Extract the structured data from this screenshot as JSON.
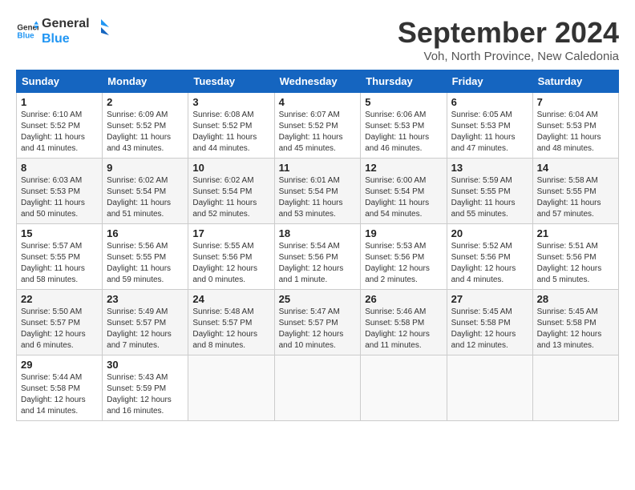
{
  "header": {
    "logo_line1": "General",
    "logo_line2": "Blue",
    "title": "September 2024",
    "subtitle": "Voh, North Province, New Caledonia"
  },
  "weekdays": [
    "Sunday",
    "Monday",
    "Tuesday",
    "Wednesday",
    "Thursday",
    "Friday",
    "Saturday"
  ],
  "weeks": [
    [
      {
        "day": "1",
        "info": "Sunrise: 6:10 AM\nSunset: 5:52 PM\nDaylight: 11 hours\nand 41 minutes."
      },
      {
        "day": "2",
        "info": "Sunrise: 6:09 AM\nSunset: 5:52 PM\nDaylight: 11 hours\nand 43 minutes."
      },
      {
        "day": "3",
        "info": "Sunrise: 6:08 AM\nSunset: 5:52 PM\nDaylight: 11 hours\nand 44 minutes."
      },
      {
        "day": "4",
        "info": "Sunrise: 6:07 AM\nSunset: 5:52 PM\nDaylight: 11 hours\nand 45 minutes."
      },
      {
        "day": "5",
        "info": "Sunrise: 6:06 AM\nSunset: 5:53 PM\nDaylight: 11 hours\nand 46 minutes."
      },
      {
        "day": "6",
        "info": "Sunrise: 6:05 AM\nSunset: 5:53 PM\nDaylight: 11 hours\nand 47 minutes."
      },
      {
        "day": "7",
        "info": "Sunrise: 6:04 AM\nSunset: 5:53 PM\nDaylight: 11 hours\nand 48 minutes."
      }
    ],
    [
      {
        "day": "8",
        "info": "Sunrise: 6:03 AM\nSunset: 5:53 PM\nDaylight: 11 hours\nand 50 minutes."
      },
      {
        "day": "9",
        "info": "Sunrise: 6:02 AM\nSunset: 5:54 PM\nDaylight: 11 hours\nand 51 minutes."
      },
      {
        "day": "10",
        "info": "Sunrise: 6:02 AM\nSunset: 5:54 PM\nDaylight: 11 hours\nand 52 minutes."
      },
      {
        "day": "11",
        "info": "Sunrise: 6:01 AM\nSunset: 5:54 PM\nDaylight: 11 hours\nand 53 minutes."
      },
      {
        "day": "12",
        "info": "Sunrise: 6:00 AM\nSunset: 5:54 PM\nDaylight: 11 hours\nand 54 minutes."
      },
      {
        "day": "13",
        "info": "Sunrise: 5:59 AM\nSunset: 5:55 PM\nDaylight: 11 hours\nand 55 minutes."
      },
      {
        "day": "14",
        "info": "Sunrise: 5:58 AM\nSunset: 5:55 PM\nDaylight: 11 hours\nand 57 minutes."
      }
    ],
    [
      {
        "day": "15",
        "info": "Sunrise: 5:57 AM\nSunset: 5:55 PM\nDaylight: 11 hours\nand 58 minutes."
      },
      {
        "day": "16",
        "info": "Sunrise: 5:56 AM\nSunset: 5:55 PM\nDaylight: 11 hours\nand 59 minutes."
      },
      {
        "day": "17",
        "info": "Sunrise: 5:55 AM\nSunset: 5:56 PM\nDaylight: 12 hours\nand 0 minutes."
      },
      {
        "day": "18",
        "info": "Sunrise: 5:54 AM\nSunset: 5:56 PM\nDaylight: 12 hours\nand 1 minute."
      },
      {
        "day": "19",
        "info": "Sunrise: 5:53 AM\nSunset: 5:56 PM\nDaylight: 12 hours\nand 2 minutes."
      },
      {
        "day": "20",
        "info": "Sunrise: 5:52 AM\nSunset: 5:56 PM\nDaylight: 12 hours\nand 4 minutes."
      },
      {
        "day": "21",
        "info": "Sunrise: 5:51 AM\nSunset: 5:56 PM\nDaylight: 12 hours\nand 5 minutes."
      }
    ],
    [
      {
        "day": "22",
        "info": "Sunrise: 5:50 AM\nSunset: 5:57 PM\nDaylight: 12 hours\nand 6 minutes."
      },
      {
        "day": "23",
        "info": "Sunrise: 5:49 AM\nSunset: 5:57 PM\nDaylight: 12 hours\nand 7 minutes."
      },
      {
        "day": "24",
        "info": "Sunrise: 5:48 AM\nSunset: 5:57 PM\nDaylight: 12 hours\nand 8 minutes."
      },
      {
        "day": "25",
        "info": "Sunrise: 5:47 AM\nSunset: 5:57 PM\nDaylight: 12 hours\nand 10 minutes."
      },
      {
        "day": "26",
        "info": "Sunrise: 5:46 AM\nSunset: 5:58 PM\nDaylight: 12 hours\nand 11 minutes."
      },
      {
        "day": "27",
        "info": "Sunrise: 5:45 AM\nSunset: 5:58 PM\nDaylight: 12 hours\nand 12 minutes."
      },
      {
        "day": "28",
        "info": "Sunrise: 5:45 AM\nSunset: 5:58 PM\nDaylight: 12 hours\nand 13 minutes."
      }
    ],
    [
      {
        "day": "29",
        "info": "Sunrise: 5:44 AM\nSunset: 5:58 PM\nDaylight: 12 hours\nand 14 minutes."
      },
      {
        "day": "30",
        "info": "Sunrise: 5:43 AM\nSunset: 5:59 PM\nDaylight: 12 hours\nand 16 minutes."
      },
      {
        "day": "",
        "info": ""
      },
      {
        "day": "",
        "info": ""
      },
      {
        "day": "",
        "info": ""
      },
      {
        "day": "",
        "info": ""
      },
      {
        "day": "",
        "info": ""
      }
    ]
  ]
}
